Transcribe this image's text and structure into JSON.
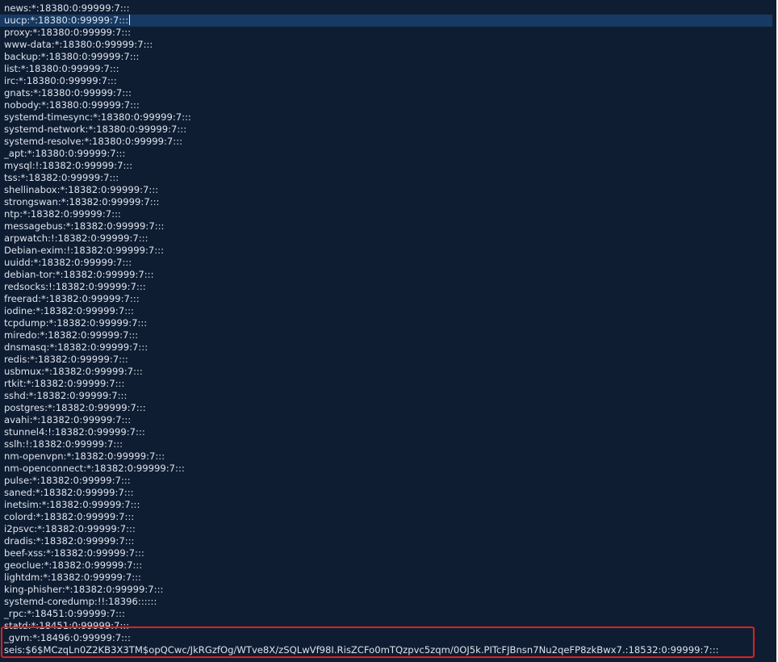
{
  "terminal": {
    "lines": [
      "news:*:18380:0:99999:7:::",
      "uucp:*:18380:0:99999:7:::",
      "proxy:*:18380:0:99999:7:::",
      "www-data:*:18380:0:99999:7:::",
      "backup:*:18380:0:99999:7:::",
      "list:*:18380:0:99999:7:::",
      "irc:*:18380:0:99999:7:::",
      "gnats:*:18380:0:99999:7:::",
      "nobody:*:18380:0:99999:7:::",
      "systemd-timesync:*:18380:0:99999:7:::",
      "systemd-network:*:18380:0:99999:7:::",
      "systemd-resolve:*:18380:0:99999:7:::",
      "_apt:*:18380:0:99999:7:::",
      "mysql:!:18382:0:99999:7:::",
      "tss:*:18382:0:99999:7:::",
      "shellinabox:*:18382:0:99999:7:::",
      "strongswan:*:18382:0:99999:7:::",
      "ntp:*:18382:0:99999:7:::",
      "messagebus:*:18382:0:99999:7:::",
      "arpwatch:!:18382:0:99999:7:::",
      "Debian-exim:!:18382:0:99999:7:::",
      "uuidd:*:18382:0:99999:7:::",
      "debian-tor:*:18382:0:99999:7:::",
      "redsocks:!:18382:0:99999:7:::",
      "freerad:*:18382:0:99999:7:::",
      "iodine:*:18382:0:99999:7:::",
      "tcpdump:*:18382:0:99999:7:::",
      "miredo:*:18382:0:99999:7:::",
      "dnsmasq:*:18382:0:99999:7:::",
      "redis:*:18382:0:99999:7:::",
      "usbmux:*:18382:0:99999:7:::",
      "rtkit:*:18382:0:99999:7:::",
      "sshd:*:18382:0:99999:7:::",
      "postgres:*:18382:0:99999:7:::",
      "avahi:*:18382:0:99999:7:::",
      "stunnel4:!:18382:0:99999:7:::",
      "sslh:!:18382:0:99999:7:::",
      "nm-openvpn:*:18382:0:99999:7:::",
      "nm-openconnect:*:18382:0:99999:7:::",
      "pulse:*:18382:0:99999:7:::",
      "saned:*:18382:0:99999:7:::",
      "inetsim:*:18382:0:99999:7:::",
      "colord:*:18382:0:99999:7:::",
      "i2psvc:*:18382:0:99999:7:::",
      "dradis:*:18382:0:99999:7:::",
      "beef-xss:*:18382:0:99999:7:::",
      "geoclue:*:18382:0:99999:7:::",
      "lightdm:*:18382:0:99999:7:::",
      "king-phisher:*:18382:0:99999:7:::",
      "systemd-coredump:!!:18396::::::",
      "_rpc:*:18451:0:99999:7:::",
      "statd:*:18451:0:99999:7:::",
      "_gvm:*:18496:0:99999:7:::",
      "seis:$6$MCzqLn0Z2KB3X3TM$opQCwc/JkRGzfOg/WTve8X/zSQLwVf98I.RisZCFo0mTQzpvc5zqm/0OJ5k.PITcFJBnsn7Nu2qeFP8zkBwx7.:18532:0:99999:7:::"
    ],
    "selected_line_index": 1
  },
  "colors": {
    "background": "#0f1d33",
    "text": "#dde3ec",
    "selection": "#163a63",
    "highlight_box": "#e0201b"
  }
}
